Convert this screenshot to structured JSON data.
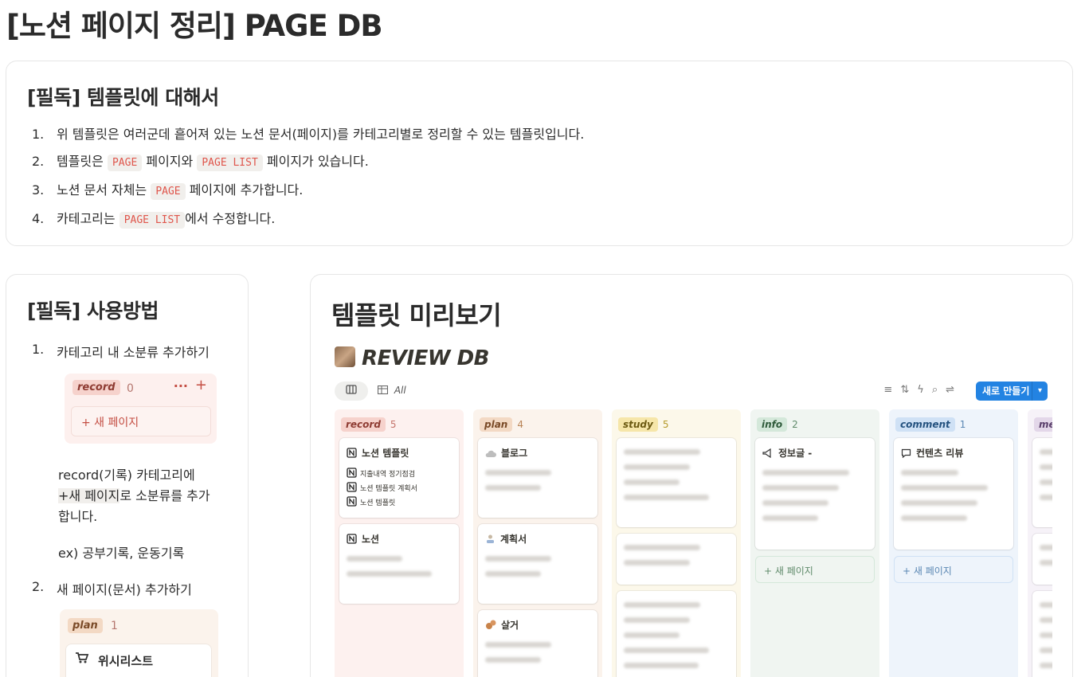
{
  "page": {
    "title": "[노션 페이지 정리] PAGE DB"
  },
  "about": {
    "heading": "[필독] 템플릿에 대해서",
    "items": [
      {
        "num": "1.",
        "parts": [
          "위 템플릿은 여러군데 흩어져 있는 노션 문서(페이지)를 카테고리별로 정리할 수 있는 템플릿입니다."
        ]
      },
      {
        "num": "2.",
        "parts": [
          "템플릿은 ",
          "PAGE",
          " 페이지와 ",
          "PAGE LIST",
          " 페이지가 있습니다."
        ]
      },
      {
        "num": "3.",
        "parts": [
          "노션 문서 자체는 ",
          "PAGE",
          " 페이지에 추가합니다."
        ]
      },
      {
        "num": "4.",
        "parts": [
          "카테고리는 ",
          "PAGE LIST",
          "에서 수정합니다."
        ]
      }
    ]
  },
  "usage": {
    "heading": "[필독] 사용방법",
    "step1": {
      "num": "1.",
      "text": "카테고리 내 소분류 추가하기"
    },
    "record_example": {
      "tag": "record",
      "count": "0",
      "dots": "···",
      "plus": "+",
      "new_page": "+  새 페이지"
    },
    "para1_line1": "record(기록) 카테고리에",
    "para1_hl": "+새 페이지",
    "para1_line2_rest": "로 소분류를 추가",
    "para1_line3": "합니다.",
    "para2": "ex) 공부기록, 운동기록",
    "step2": {
      "num": "2.",
      "text": "새 페이지(문서) 추가하기"
    },
    "plan_example": {
      "tag": "plan",
      "count": "1",
      "card_icon": "cart-icon",
      "card_label": "위시리스트"
    }
  },
  "preview": {
    "heading": "템플릿 미리보기",
    "db_title": "REVIEW DB",
    "view_all": "All",
    "new_button": "새로 만들기",
    "columns": [
      {
        "tag": "record",
        "count": "5",
        "bg": "#fdf1ef",
        "pill_bg": "#f6d2cc",
        "pill_fg": "#8e3b32",
        "count_fg": "#c4736a",
        "cards": [
          {
            "title": "노션 템플릿",
            "icon": "notion-icon",
            "lines": [
              "지출내역 정기점검",
              "노션 템플릿 계획서",
              "노션 템플릿"
            ]
          },
          {
            "title": "노션",
            "icon": "notion-icon",
            "lines": []
          }
        ]
      },
      {
        "tag": "plan",
        "count": "4",
        "bg": "#fbf3ec",
        "pill_bg": "#f3d9c4",
        "pill_fg": "#7a4a27",
        "count_fg": "#b98456",
        "cards": [
          {
            "title": "블로그",
            "icon": "cloud-icon",
            "lines": []
          },
          {
            "title": "계획서",
            "icon": "person-icon",
            "lines": []
          },
          {
            "title": "살거",
            "icon": "squirrel-icon",
            "lines": []
          }
        ]
      },
      {
        "tag": "study",
        "count": "5",
        "bg": "#fcf8ea",
        "pill_bg": "#f6e6a9",
        "pill_fg": "#6c5a12",
        "count_fg": "#b59a2a",
        "cards": []
      },
      {
        "tag": "info",
        "count": "2",
        "bg": "#f0f5f1",
        "pill_bg": "#d4e8da",
        "pill_fg": "#2f5b3b",
        "count_fg": "#5f8a6a",
        "cards": [
          {
            "title": "정보글 -",
            "icon": "megaphone-icon",
            "lines": []
          }
        ],
        "new_page": "+ 새 페이지"
      },
      {
        "tag": "comment",
        "count": "1",
        "bg": "#eef4fb",
        "pill_bg": "#cfe1f5",
        "pill_fg": "#24527f",
        "count_fg": "#5a87b3",
        "cards": [
          {
            "title": "컨텐츠 리뷰",
            "icon": "speech-icon",
            "lines": []
          }
        ],
        "new_page": "+ 새 페이지"
      },
      {
        "tag": "mem",
        "count": "",
        "bg": "#f6f2f8",
        "pill_bg": "#e3d7e9",
        "pill_fg": "#5a3f6b",
        "count_fg": "#8b6e9b",
        "cards": []
      }
    ]
  }
}
